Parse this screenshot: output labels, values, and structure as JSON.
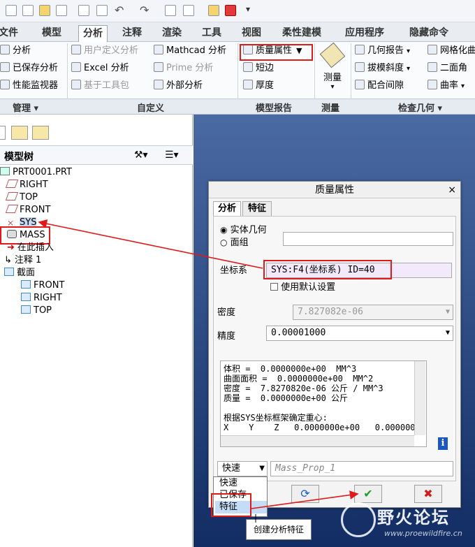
{
  "tabs": [
    "文件",
    "模型",
    "分析",
    "注释",
    "渲染",
    "工具",
    "视图",
    "柔性建模",
    "应用程序",
    "隐藏命令"
  ],
  "ribbon": {
    "col1": [
      "分析",
      "已保存分析",
      "性能监视器"
    ],
    "col2": [
      "用户定义分析",
      "Excel 分析",
      "基于工具包"
    ],
    "col3": [
      "Mathcad 分析",
      "Prime 分析",
      "外部分析"
    ],
    "col4": [
      "质量属性",
      "短边",
      "厚度"
    ],
    "measure": "测量",
    "col5": [
      "几何报告",
      "拔模斜度",
      "配合间隙"
    ],
    "col6": [
      "网格化曲",
      "二面角",
      "曲率"
    ]
  },
  "groups": [
    "管理",
    "自定义",
    "模型报告",
    "测量",
    "检查几何"
  ],
  "left_panel": {
    "title": "模型树",
    "tree": [
      "PRT0001.PRT",
      "RIGHT",
      "TOP",
      "FRONT",
      "SYS",
      "MASS",
      "在此插入",
      "注释 1",
      "截面",
      "FRONT",
      "RIGHT",
      "TOP"
    ]
  },
  "dialog": {
    "title": "质量属性",
    "close": "×",
    "tabs": [
      "分析",
      "特征"
    ],
    "radio1": "实体几何",
    "radio2": "面组",
    "csys_label": "坐标系",
    "csys_value": "SYS:F4(坐标系) ID=40",
    "use_default": "使用默认设置",
    "density_label": "密度",
    "density_value": "7.827082e-06",
    "precision_label": "精度",
    "precision_value": "0.00001000",
    "results": [
      "体积 =  0.0000000e+00  MM^3",
      "曲面面积 =  0.0000000e+00  MM^2",
      "密度 =  7.8270820e-06 公斤 / MM^3",
      "质量 =  0.0000000e+00 公斤",
      "",
      "根据SYS坐标框架确定重心:",
      "X    Y    Z   0.0000000e+00   0.000000"
    ],
    "mode_value": "快速",
    "name_value": "Mass_Prop_1",
    "ok_icon": "✔",
    "cancel_icon": "✖"
  },
  "dropdown": [
    "快速",
    "已保存",
    "特征"
  ],
  "tooltip": "创建分析特征",
  "watermark": {
    "title": "野火论坛",
    "url": "www.proewildfire.cn"
  },
  "colors": {
    "highlight": "#e0191b",
    "canvas_top": "#4a6aa4",
    "canvas_bottom": "#122d64",
    "ok": "#1e9d2a",
    "cancel": "#d21c1c"
  }
}
